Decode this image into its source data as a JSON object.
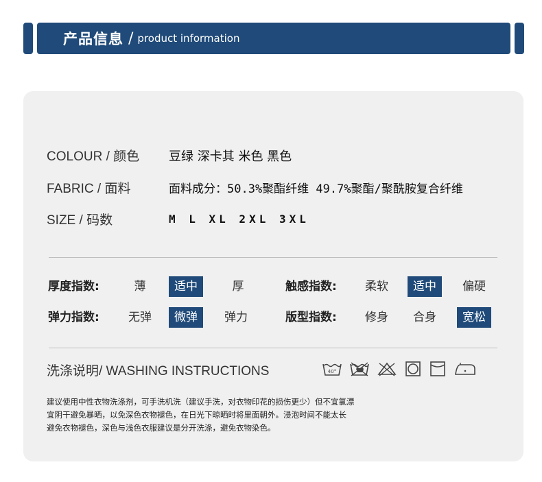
{
  "header": {
    "title_cn": "产品信息",
    "separator": "/",
    "title_en": "product information"
  },
  "info": [
    {
      "label": "COLOUR / 颜色",
      "value": "豆绿  深卡其  米色  黑色"
    },
    {
      "label": "FABRIC / 面料",
      "value": "面料成分：50.3%聚酯纤维  49.7%聚酯/聚酰胺复合纤维"
    },
    {
      "label": "SIZE / 码数",
      "value": "M L XL 2XL 3XL"
    }
  ],
  "indices": {
    "thickness": {
      "label": "厚度指数:",
      "options": [
        "薄",
        "适中",
        "厚"
      ],
      "selected": "适中"
    },
    "touch": {
      "label": "触感指数:",
      "options": [
        "柔软",
        "适中",
        "偏硬"
      ],
      "selected": "适中"
    },
    "elasticity": {
      "label": "弹力指数:",
      "options": [
        "无弹",
        "微弹",
        "弹力"
      ],
      "selected": "微弹"
    },
    "fit": {
      "label": "版型指数:",
      "options": [
        "修身",
        "合身",
        "宽松"
      ],
      "selected": "宽松"
    }
  },
  "washing": {
    "title": "洗涤说明/ WASHING INSTRUCTIONS",
    "icons": [
      "wash-40-icon",
      "no-hand-wash-icon",
      "no-bleach-icon",
      "tumble-dry-icon",
      "hang-dry-icon",
      "iron-icon"
    ],
    "wash_temp": "40°",
    "note_lines": [
      "建议使用中性衣物洗涤剂，可手洗机洗（建议手洗，对衣物印花的损伤更少）但不宜氯漂",
      "宜阴干避免暴晒，以免深色衣物褪色，在日光下晾晒时将里面朝外。浸泡时间不能太长",
      "避免衣物褪色，深色与浅色衣服建议是分开洗涤，避免衣物染色。"
    ]
  },
  "colors": {
    "accent": "#1f4a79",
    "panel": "#f0f0f0"
  }
}
